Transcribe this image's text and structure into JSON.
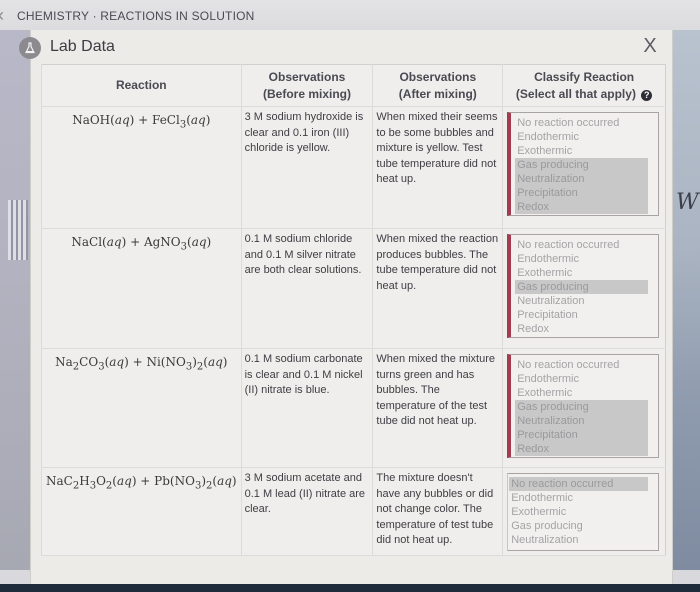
{
  "topbar": {
    "breadcrumb": "CHEMISTRY · REACTIONS IN SOLUTION",
    "back_icon": "chevron-left-icon"
  },
  "panel": {
    "title": "Lab Data",
    "title_icon": "flask-icon",
    "close_label": "X"
  },
  "table": {
    "headers": {
      "reaction": "Reaction",
      "before_line1": "Observations",
      "before_line2": "(Before mixing)",
      "after_line1": "Observations",
      "after_line2": "(After mixing)",
      "classify_line1": "Classify Reaction",
      "classify_line2": "(Select all that apply)",
      "help_icon": "?"
    },
    "rows": [
      {
        "reaction": "NaOH(aq) + FeCl3(aq)",
        "before": "3 M sodium hydroxide is clear and 0.1 iron (III) chloride is yellow.",
        "after": "When mixed their seems to be some bubbles and mixture is yellow. Test tube temperature did not heat up.",
        "options": [
          "No reaction occurred",
          "Endothermic",
          "Exothermic",
          "Gas producing",
          "Neutralization",
          "Precipitation",
          "Redox"
        ],
        "selected": [
          "Gas producing",
          "Neutralization",
          "Precipitation",
          "Redox"
        ]
      },
      {
        "reaction": "NaCl(aq) + AgNO3(aq)",
        "before": "0.1 M sodium chloride and 0.1 M silver nitrate are both clear solutions.",
        "after": "When mixed the reaction produces bubbles. The tube temperature did not heat up.",
        "options": [
          "No reaction occurred",
          "Endothermic",
          "Exothermic",
          "Gas producing",
          "Neutralization",
          "Precipitation",
          "Redox"
        ],
        "selected": [
          "Gas producing"
        ]
      },
      {
        "reaction": "Na2CO3(aq) + Ni(NO3)2(aq)",
        "before": "0.1 M sodium carbonate is clear and 0.1 M nickel (II) nitrate is blue.",
        "after": "When mixed the mixture turns green and has bubbles. The temperature of the test tube did not heat up.",
        "options": [
          "No reaction occurred",
          "Endothermic",
          "Exothermic",
          "Gas producing",
          "Neutralization",
          "Precipitation",
          "Redox"
        ],
        "selected": [
          "Gas producing",
          "Neutralization",
          "Precipitation",
          "Redox"
        ]
      },
      {
        "reaction": "NaC2H3O2(aq) + Pb(NO3)2(aq)",
        "before": "3 M sodium acetate and 0.1 M lead (II) nitrate are clear.",
        "after": "The mixture doesn't have any bubbles or did not change color. The temperature of test tube did not heat up.",
        "options": [
          "No reaction occurred",
          "Endothermic",
          "Exothermic",
          "Gas producing",
          "Neutralization"
        ],
        "selected": [
          "No reaction occurred"
        ]
      }
    ]
  },
  "background": {
    "right_handwriting": "W"
  }
}
